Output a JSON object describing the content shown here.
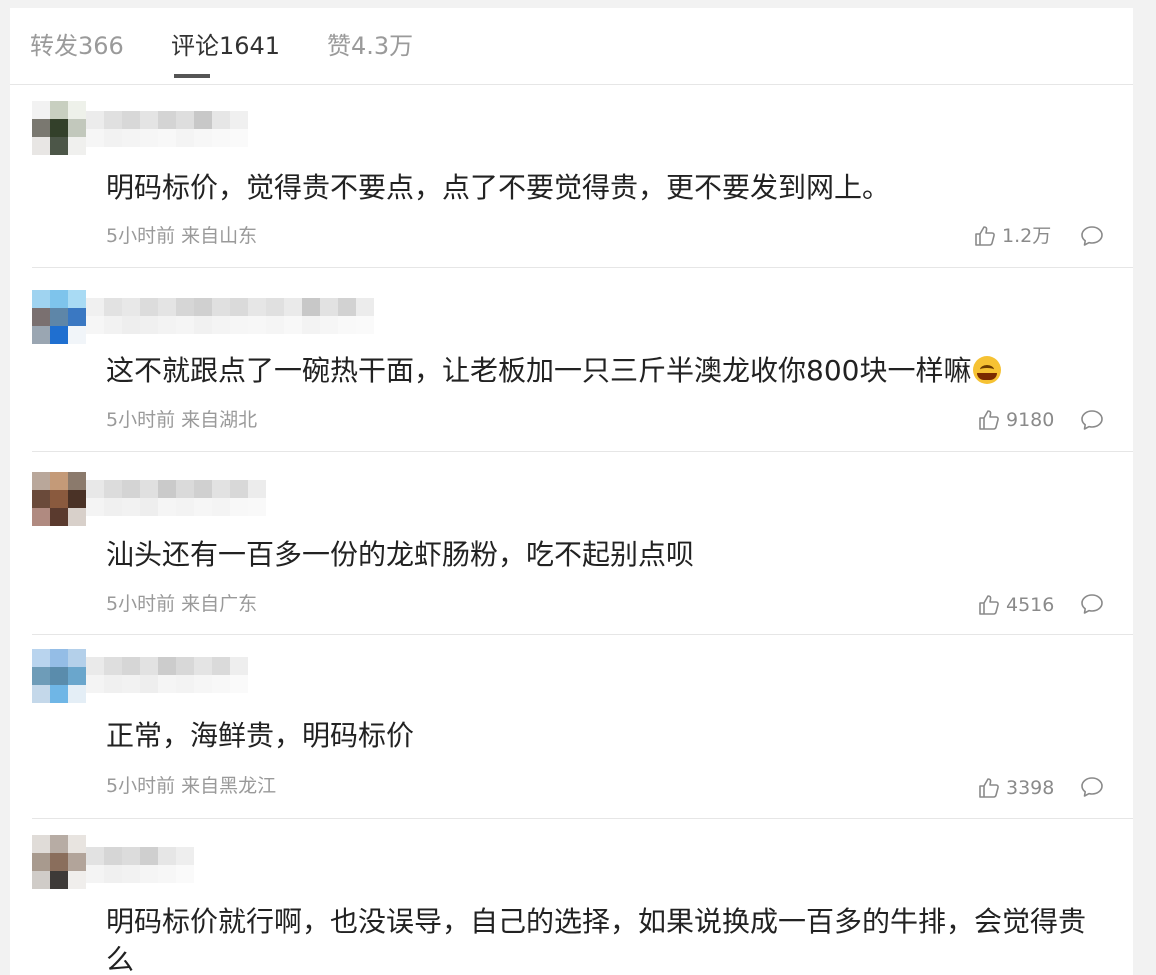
{
  "tabs": [
    {
      "label": "转发366",
      "active": false
    },
    {
      "label": "评论1641",
      "active": true
    },
    {
      "label": "赞4.3万",
      "active": false
    }
  ],
  "comments": [
    {
      "text": "明码标价，觉得贵不要点，点了不要觉得贵，更不要发到网上。",
      "meta": "5小时前 来自山东",
      "likes": "1.2万"
    },
    {
      "text": "这不就跟点了一碗热干面，让老板加一只三斤半澳龙收你800块一样嘛",
      "meta": "5小时前 来自湖北",
      "likes": "9180",
      "emoji": "laugh-cry-emoji"
    },
    {
      "text": "汕头还有一百多一份的龙虾肠粉，吃不起别点呗",
      "meta": "5小时前 来自广东",
      "likes": "4516"
    },
    {
      "text": "正常，海鲜贵，明码标价",
      "meta": "5小时前 来自黑龙江",
      "likes": "3398"
    },
    {
      "text": "明码标价就行啊，也没误导，自己的选择，如果说换成一百多的牛排，会觉得贵么",
      "meta": "",
      "likes": ""
    }
  ],
  "icons": {
    "like": "thumbs-up-icon",
    "reply": "comment-bubble-icon"
  },
  "colors": {
    "text_primary": "#222222",
    "text_secondary": "#9a9a9a",
    "background": "#f2f2f2",
    "panel": "#ffffff"
  }
}
